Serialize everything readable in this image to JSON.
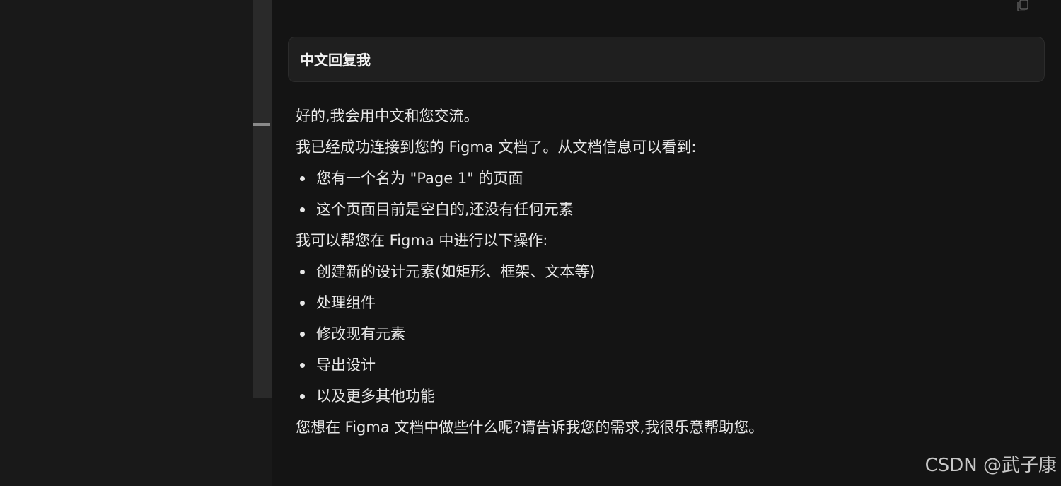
{
  "colors": {
    "sidebar_bg": "#191919",
    "chat_bg": "#141414",
    "bubble_bg": "#1f1f1f",
    "text": "#e8e8e8",
    "scroll_thumb": "#8a8a8a"
  },
  "icons": {
    "copy": "copy-icon"
  },
  "user_message": {
    "text": "中文回复我"
  },
  "assistant_message": {
    "greeting": "好的,我会用中文和您交流。",
    "connected": "我已经成功连接到您的 Figma 文档了。从文档信息可以看到:",
    "doc_info": [
      "您有一个名为 \"Page 1\" 的页面",
      "这个页面目前是空白的,还没有任何元素"
    ],
    "can_help": "我可以帮您在 Figma 中进行以下操作:",
    "operations": [
      "创建新的设计元素(如矩形、框架、文本等)",
      "处理组件",
      "修改现有元素",
      "导出设计",
      "以及更多其他功能"
    ],
    "closing": "您想在 Figma 文档中做些什么呢?请告诉我您的需求,我很乐意帮助您。"
  },
  "watermark": "CSDN @武子康"
}
